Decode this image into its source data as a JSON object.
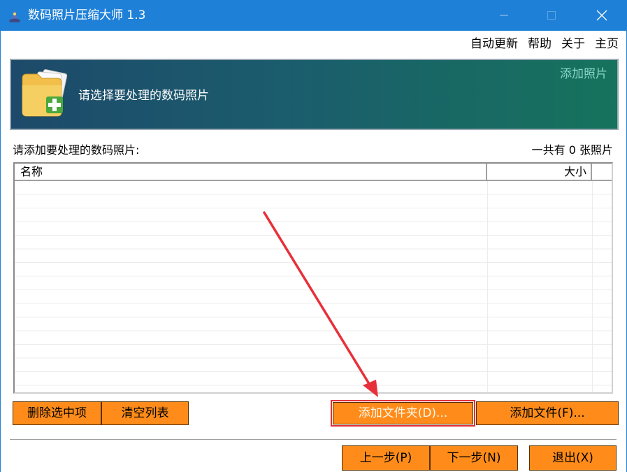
{
  "window": {
    "title": "数码照片压缩大师 1.3"
  },
  "menu": {
    "items": [
      "自动更新",
      "帮助",
      "关于",
      "主页"
    ]
  },
  "banner": {
    "subtitle": "请选择要处理的数码照片",
    "step": "添加照片"
  },
  "list": {
    "caption": "请添加要处理的数码照片:",
    "count": "一共有 0 张照片",
    "columns": [
      "名称",
      "大小"
    ]
  },
  "buttons": {
    "delete_selected": "删除选中项",
    "clear_list": "清空列表",
    "add_folder": "添加文件夹(D)...",
    "add_file": "添加文件(F)...",
    "prev": "上一步(P)",
    "next": "下一步(N)",
    "exit": "退出(X)"
  },
  "colors": {
    "titlebar": "#1f80d7",
    "button": "#ff8c1a",
    "highlight": "#e0303a",
    "banner_start": "#1d4a6a",
    "banner_end": "#16735c"
  },
  "icons": [
    "app-icon",
    "minimize-icon",
    "maximize-icon",
    "close-icon",
    "folder-add-icon",
    "annotation-arrow"
  ]
}
